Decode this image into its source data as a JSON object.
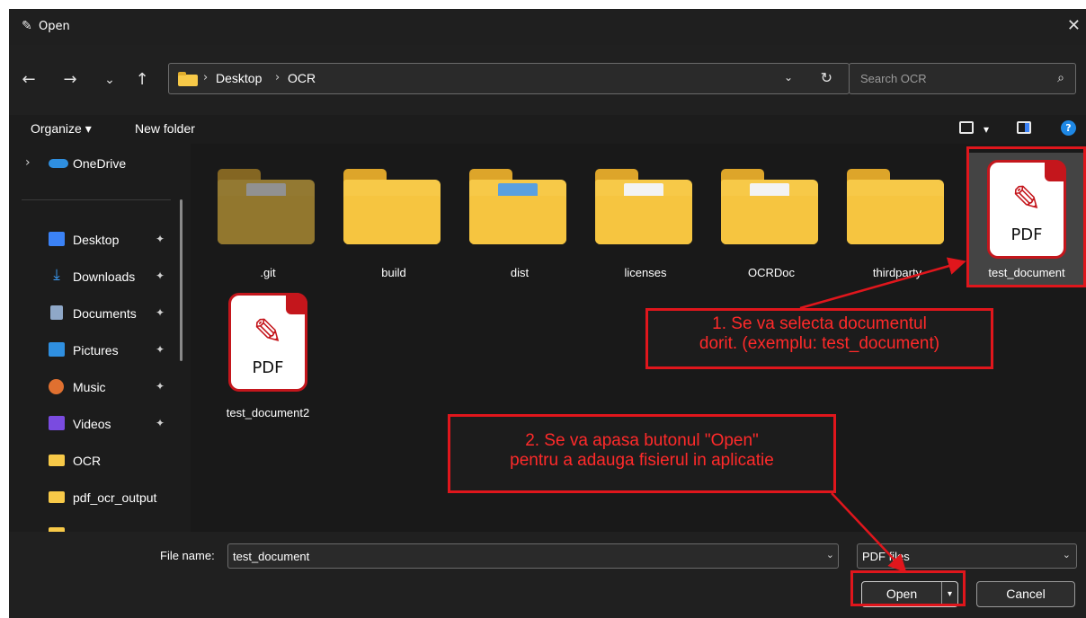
{
  "window": {
    "title": "Open",
    "close_glyph": "✕"
  },
  "nav": {
    "back_glyph": "←",
    "forward_glyph": "→",
    "recent_glyph": "⌄",
    "up_glyph": "↑",
    "breadcrumb": [
      "Desktop",
      "OCR"
    ],
    "crumb_sep": "›",
    "dropdown_glyph": "⌄",
    "refresh_glyph": "↻",
    "search_placeholder": "Search OCR",
    "search_glyph": "⌕"
  },
  "toolbar": {
    "organize": "Organize ▾",
    "new_folder": "New folder",
    "view_dropdown": "▾",
    "help": "?"
  },
  "sidebar": {
    "onedrive": "OneDrive",
    "expand_glyph": "›",
    "pin_glyph": "📌",
    "items": [
      {
        "label": "Desktop",
        "icon_color": "#3b82f6",
        "pinned": true
      },
      {
        "label": "Downloads",
        "icon_color": "#3b9cf6",
        "pinned": true
      },
      {
        "label": "Documents",
        "icon_color": "#8fa8c8",
        "pinned": true
      },
      {
        "label": "Pictures",
        "icon_color": "#2f8fe0",
        "pinned": true
      },
      {
        "label": "Music",
        "icon_color": "#e07030",
        "pinned": true
      },
      {
        "label": "Videos",
        "icon_color": "#7a4be0",
        "pinned": true
      },
      {
        "label": "OCR",
        "icon_color": "#f7c948",
        "pinned": false
      },
      {
        "label": "pdf_ocr_output",
        "icon_color": "#f7c948",
        "pinned": false
      }
    ]
  },
  "files": [
    {
      "name": ".git",
      "type": "folder"
    },
    {
      "name": "build",
      "type": "folder"
    },
    {
      "name": "dist",
      "type": "folder"
    },
    {
      "name": "licenses",
      "type": "folder"
    },
    {
      "name": "OCRDoc",
      "type": "folder"
    },
    {
      "name": "thirdparty",
      "type": "folder"
    },
    {
      "name": "test_document",
      "type": "pdf",
      "selected": true
    },
    {
      "name": "test_document2",
      "type": "pdf"
    }
  ],
  "pdf_label": "PDF",
  "pdf_glyph": "✎",
  "annotations": {
    "step1_line1": "1. Se va selecta documentul",
    "step1_line2": "dorit. (exemplu: test_document)",
    "step2_line1": "2. Se va apasa butonul \"Open\"",
    "step2_line2": "pentru a adauga fisierul in aplicatie"
  },
  "footer": {
    "file_name_label": "File name:",
    "file_name_value": "test_document",
    "file_type_value": "PDF files",
    "drop_glyph": "⌄",
    "open_label": "Open",
    "open_split_glyph": "▾",
    "cancel_label": "Cancel"
  },
  "colors": {
    "annotation_red": "#e0161c",
    "folder_yellow": "#f7c948",
    "background": "#1c1c1c"
  }
}
